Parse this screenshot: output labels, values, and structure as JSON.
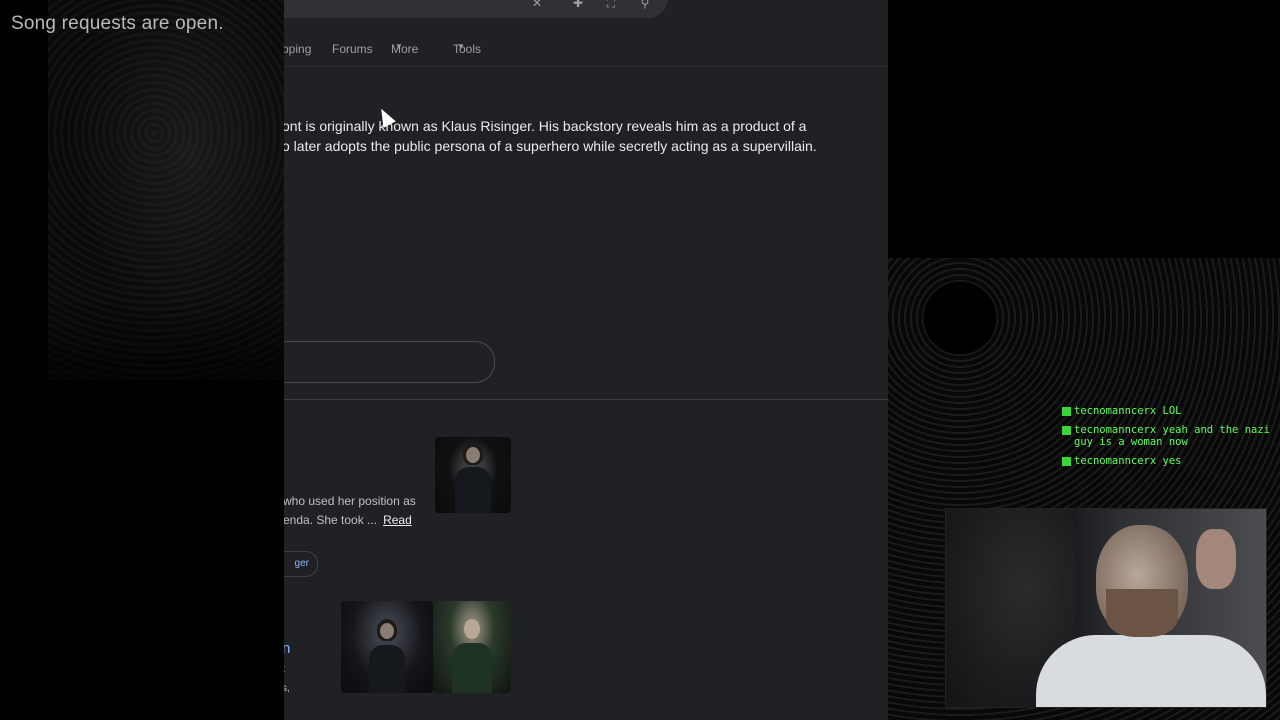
{
  "overlay": {
    "song_requests": "Song requests are open."
  },
  "browser": {
    "nav": {
      "shopping_fragment": "pping",
      "forums": "Forums",
      "more": "More",
      "tools": "Tools"
    },
    "ai_overview": {
      "line1": "ont is originally known as Klaus Risinger. His backstory reveals him as a product of a",
      "line2": "o later adopts the public persona of a superhero while secretly acting as a supervillain."
    },
    "result1": {
      "snippet_line1": "who used her position as",
      "snippet_line2": "enda. She took ...",
      "read_link": "Read",
      "chip_fragment": "ger"
    },
    "result2": {
      "title_fragment": "n",
      "text_fragment1": "t",
      "text_fragment2": "s,"
    }
  },
  "chat": {
    "messages": [
      {
        "user": "tecnomanncerx",
        "text": "LOL"
      },
      {
        "user": "tecnomanncerx",
        "text": "yeah and the nazi guy is a woman now"
      },
      {
        "user": "tecnomanncerx",
        "text": "yes"
      }
    ]
  },
  "colors": {
    "browser_bg": "#202124",
    "chat_green": "#5cff5c",
    "link_blue": "#8ab4f8"
  }
}
